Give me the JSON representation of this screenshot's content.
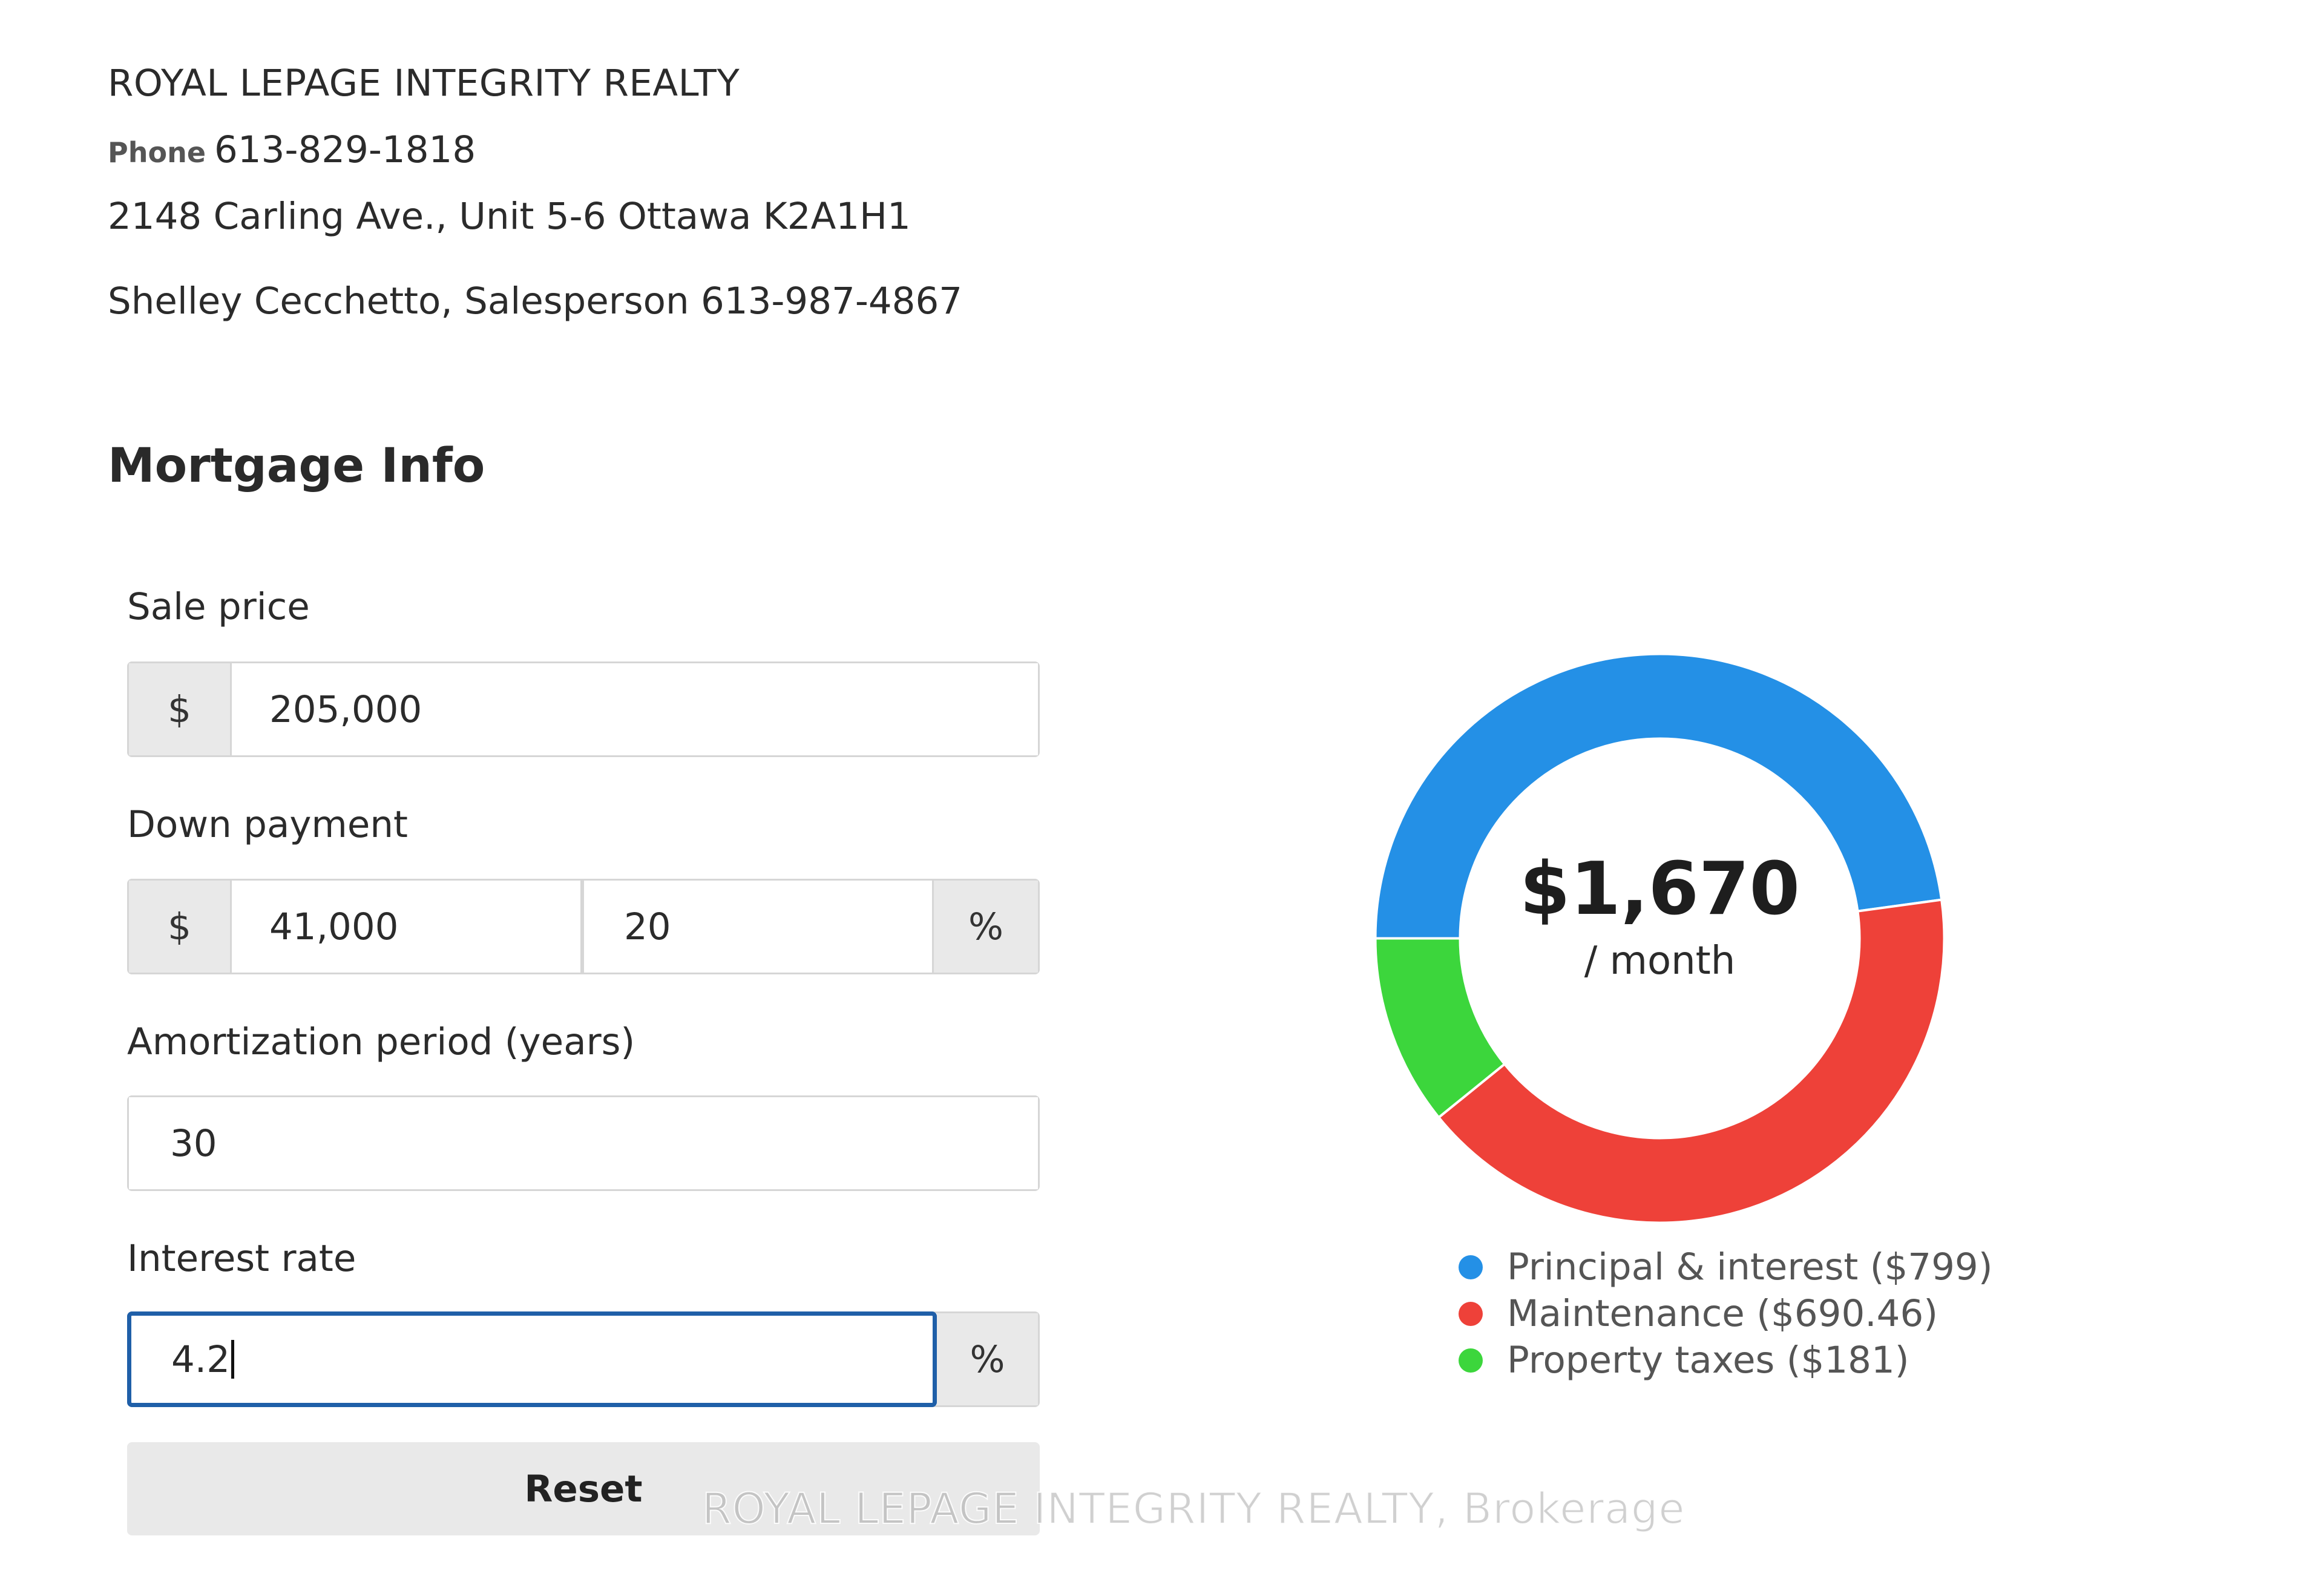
{
  "brokerage": {
    "name": "ROYAL LEPAGE INTEGRITY REALTY",
    "phone_label": "Phone",
    "phone": "613-829-1818",
    "address": "2148 Carling Ave., Unit 5-6 Ottawa K2A1H1",
    "agent": "Shelley Cecchetto, Salesperson 613-987-4867"
  },
  "mortgage": {
    "title": "Mortgage Info",
    "sale_price": {
      "label": "Sale price",
      "currency_symbol": "$",
      "value": "205,000"
    },
    "down_payment": {
      "label": "Down payment",
      "currency_symbol": "$",
      "amount": "41,000",
      "percent": "20",
      "percent_symbol": "%"
    },
    "amortization": {
      "label": "Amortization period (years)",
      "value": "30"
    },
    "interest_rate": {
      "label": "Interest rate",
      "value": "4.2",
      "percent_symbol": "%"
    },
    "reset_label": "Reset"
  },
  "summary": {
    "amount": "$1,670",
    "unit": "/ month"
  },
  "chart_data": {
    "type": "pie",
    "donut": true,
    "categories": [
      "Principal & interest ($799)",
      "Maintenance ($690.46)",
      "Property taxes ($181)"
    ],
    "values": [
      799,
      690.46,
      181
    ],
    "colors": [
      "#2490e6",
      "#ee4139",
      "#3cd63c"
    ],
    "start": "left-horizontal",
    "direction": "clockwise",
    "legend": "bottom"
  },
  "watermark": "ROYAL LEPAGE INTEGRITY REALTY, Brokerage",
  "colors": {
    "focus_border": "#1f5fa8",
    "addon_bg": "#e9e9e9",
    "border": "#d6d6d6"
  }
}
